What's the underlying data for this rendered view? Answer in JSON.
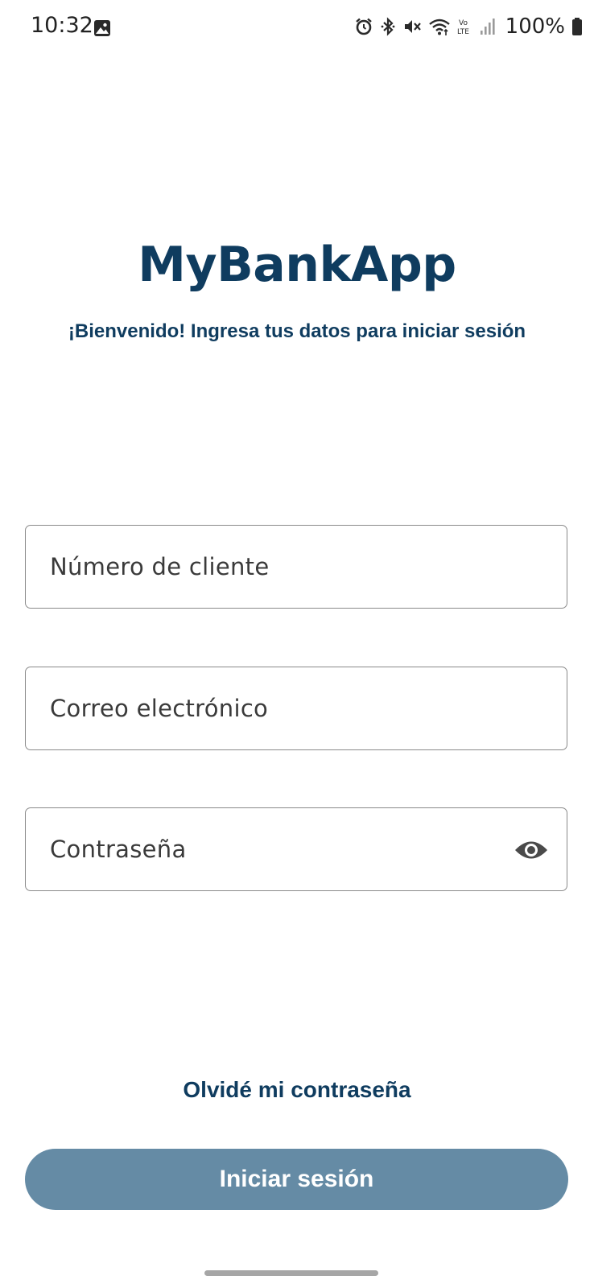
{
  "status_bar": {
    "time": "10:32",
    "battery_percent": "100%",
    "volte_top": "Vo",
    "volte_bottom": "LTE",
    "icons": [
      "gallery-icon",
      "alarm-icon",
      "bluetooth-icon",
      "mute-icon",
      "wifi-icon",
      "volte-icon",
      "signal-icon",
      "battery-icon"
    ]
  },
  "header": {
    "title": "MyBankApp",
    "subtitle": "¡Bienvenido! Ingresa tus datos para iniciar sesión"
  },
  "form": {
    "client_number": {
      "placeholder": "Número de cliente",
      "value": ""
    },
    "email": {
      "placeholder": "Correo electrónico",
      "value": ""
    },
    "password": {
      "placeholder": "Contraseña",
      "value": "",
      "toggle_icon": "eye-icon"
    }
  },
  "forgot_password_label": "Olvidé mi contraseña",
  "login_button_label": "Iniciar sesión",
  "colors": {
    "brand": "#0f3c5f",
    "button_bg": "#658ba5",
    "field_border": "#8a8a8a"
  }
}
